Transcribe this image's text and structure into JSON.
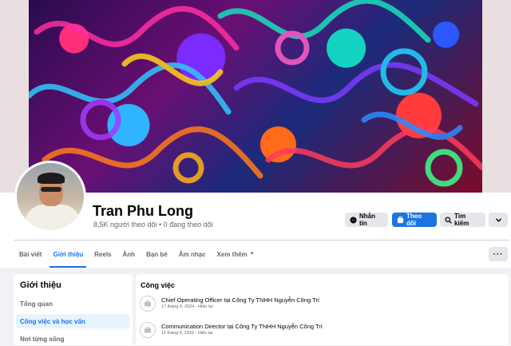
{
  "profile": {
    "name": "Tran Phu Long",
    "stats": "8,5K người theo dõi • 0 đang theo dõi"
  },
  "actions": {
    "message_label": "Nhắn tin",
    "follow_label": "Theo dõi",
    "search_label": "Tìm kiếm"
  },
  "tabs": [
    {
      "label": "Bài viết"
    },
    {
      "label": "Giới thiệu"
    },
    {
      "label": "Reels"
    },
    {
      "label": "Ảnh"
    },
    {
      "label": "Bạn bè"
    },
    {
      "label": "Âm nhạc"
    },
    {
      "label": "Xem thêm"
    }
  ],
  "about": {
    "heading": "Giới thiệu",
    "items": [
      {
        "label": "Tổng quan"
      },
      {
        "label": "Công việc và học vấn"
      },
      {
        "label": "Nơi từng sống"
      }
    ]
  },
  "work": {
    "heading": "Công việc",
    "items": [
      {
        "title": "Chief Operating Officer tại Công Ty TNHH Nguyễn Công Trí",
        "sub": "17 tháng 9, 2024 - Hiện tại"
      },
      {
        "title": "Communication Director tại Công Ty TNHH Nguyễn Công Trí",
        "sub": "11 tháng 9, 2016 - Hiện tại"
      }
    ]
  },
  "colors": {
    "accent": "#1b74e4",
    "background": "#f0f2f5",
    "secondary_text": "#65676b",
    "button_gray": "#e4e6eb"
  },
  "icons": [
    "messenger-icon",
    "follow-icon",
    "search-icon",
    "chevron-down-icon",
    "more-icon",
    "briefcase-icon"
  ]
}
